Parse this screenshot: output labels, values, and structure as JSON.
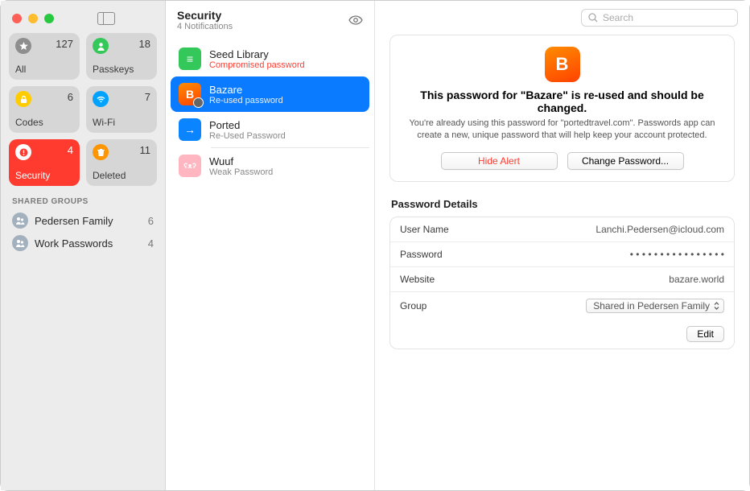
{
  "sidebar": {
    "tiles": [
      {
        "label": "All",
        "count": 127,
        "icon": "star",
        "color": "#8e8e8e"
      },
      {
        "label": "Passkeys",
        "count": 18,
        "icon": "person",
        "color": "#34c759"
      },
      {
        "label": "Codes",
        "count": 6,
        "icon": "lock",
        "color": "#ffcc00"
      },
      {
        "label": "Wi-Fi",
        "count": 7,
        "icon": "wifi",
        "color": "#00a2ff"
      },
      {
        "label": "Security",
        "count": 4,
        "icon": "alert",
        "color": "#ff3b30",
        "active": true
      },
      {
        "label": "Deleted",
        "count": 11,
        "icon": "trash",
        "color": "#ff9500"
      }
    ],
    "shared_header": "SHARED GROUPS",
    "groups": [
      {
        "name": "Pedersen Family",
        "count": 6
      },
      {
        "name": "Work Passwords",
        "count": 4
      }
    ]
  },
  "list": {
    "title": "Security",
    "subtitle": "4 Notifications",
    "items": [
      {
        "title": "Seed Library",
        "subtitle": "Compromised password",
        "warn": true,
        "icon_bg": "#34c759",
        "icon_text": "≡"
      },
      {
        "title": "Bazare",
        "subtitle": "Re-used password",
        "warn": false,
        "icon_bg": "linear-gradient(160deg,#ff8c00,#ff4200)",
        "icon_text": "B",
        "active": true
      },
      {
        "title": "Ported",
        "subtitle": "Re-Used Password",
        "warn": false,
        "icon_bg": "#0a84ff",
        "icon_text": "→"
      },
      {
        "title": "Wuuf",
        "subtitle": "Weak Password",
        "warn": false,
        "icon_bg": "#ffb6c1",
        "icon_text": "ʕᴥʔ"
      }
    ]
  },
  "search": {
    "placeholder": "Search"
  },
  "alert": {
    "icon_text": "B",
    "title": "This password for \"Bazare\" is re-used and should be changed.",
    "description": "You're already using this password for \"portedtravel.com\". Passwords app can create a new, unique password that will help keep your account protected.",
    "hide_label": "Hide Alert",
    "change_label": "Change Password..."
  },
  "details": {
    "section_title": "Password Details",
    "rows": {
      "username_label": "User Name",
      "username_value": "Lanchi.Pedersen@icloud.com",
      "password_label": "Password",
      "password_value": "• • • • • • • • • • • • • • • •",
      "website_label": "Website",
      "website_value": "bazare.world",
      "group_label": "Group",
      "group_value": "Shared in Pedersen Family"
    },
    "edit_label": "Edit"
  }
}
